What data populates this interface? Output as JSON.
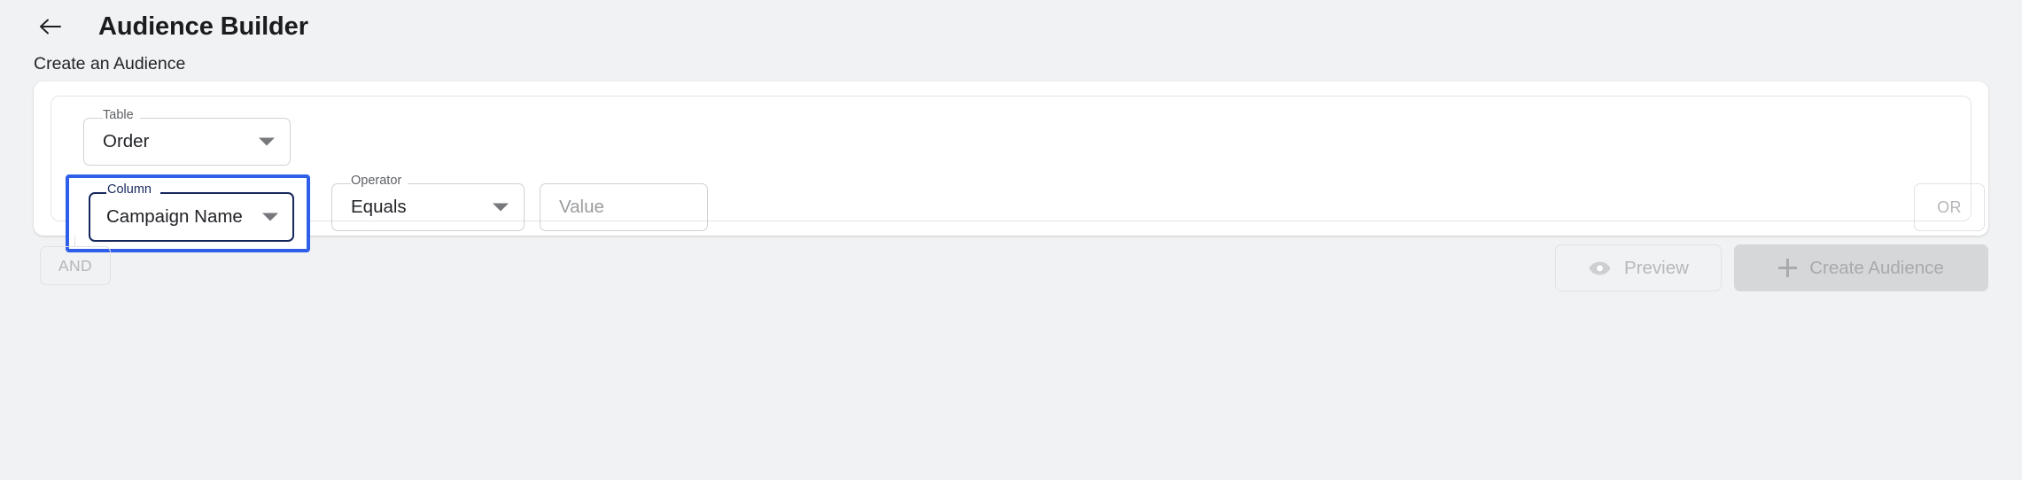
{
  "header": {
    "back_icon": "arrow-left-icon",
    "title": "Audience Builder",
    "subtitle": "Create an Audience"
  },
  "builder": {
    "table_field": {
      "label": "Table",
      "value": "Order",
      "arrow_icon": "chevron-down-icon"
    },
    "column_field": {
      "label": "Column",
      "value": "Campaign Name",
      "arrow_icon": "chevron-down-icon",
      "focused": "true",
      "focus_ring_color": "#2f5fe8",
      "border_color": "#15275c"
    },
    "operator_field": {
      "label": "Operator",
      "value": "Equals",
      "arrow_icon": "chevron-down-icon"
    },
    "value_field": {
      "placeholder": "Value",
      "value": ""
    },
    "or_button": {
      "label": "OR",
      "disabled": "true"
    }
  },
  "footer": {
    "and_button": {
      "label": "AND",
      "disabled": "true"
    },
    "preview_button": {
      "label": "Preview",
      "icon": "eye-icon",
      "disabled": "true"
    },
    "create_button": {
      "label": "Create Audience",
      "icon": "plus-icon",
      "disabled": "true"
    }
  }
}
